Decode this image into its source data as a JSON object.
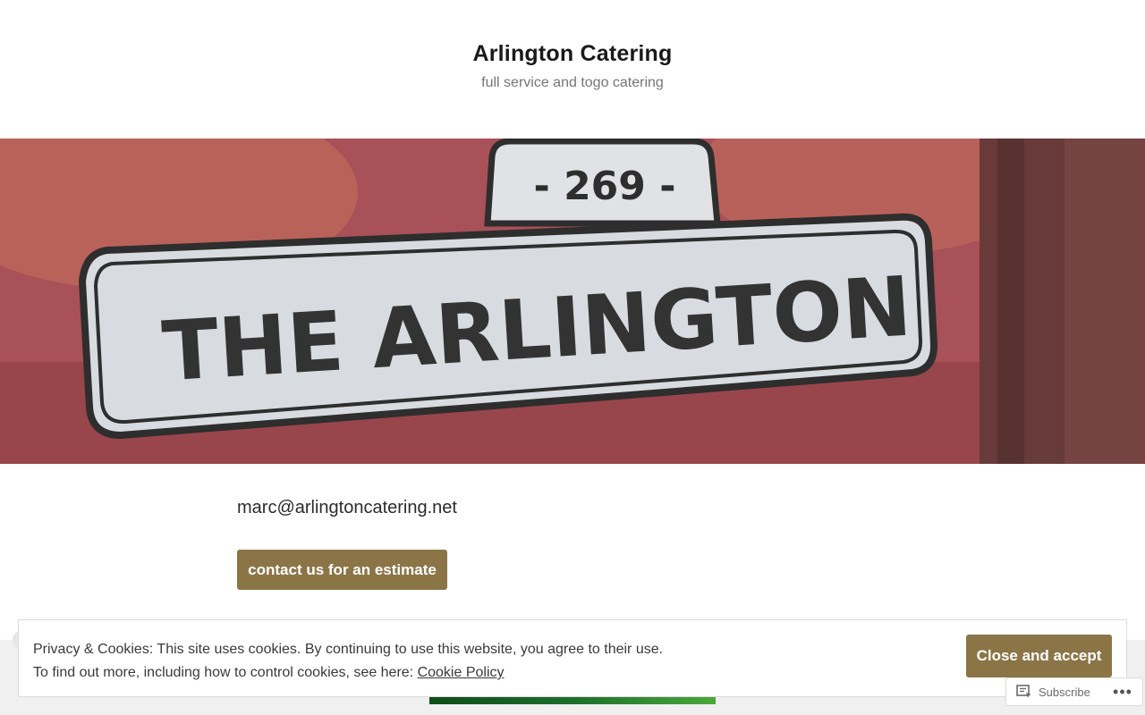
{
  "header": {
    "title": "Arlington Catering",
    "tagline": "full service and togo catering"
  },
  "hero": {
    "sign_number": "- 269 -",
    "sign_text": "THE ARLINGTON"
  },
  "content": {
    "email": "marc@arlingtoncatering.net",
    "estimate_button": "contact us for an estimate"
  },
  "cookie_banner": {
    "line1": "Privacy & Cookies: This site uses cookies. By continuing to use this website, you agree to their use.",
    "line2_prefix": "To find out more, including how to control cookies, see here: ",
    "link_label": "Cookie Policy",
    "accept_button": "Close and accept"
  },
  "actionbar": {
    "subscribe_label": "Subscribe",
    "more_label": "•••"
  },
  "colors": {
    "button": "#8b7547",
    "hero_red": "#9b3a40"
  }
}
